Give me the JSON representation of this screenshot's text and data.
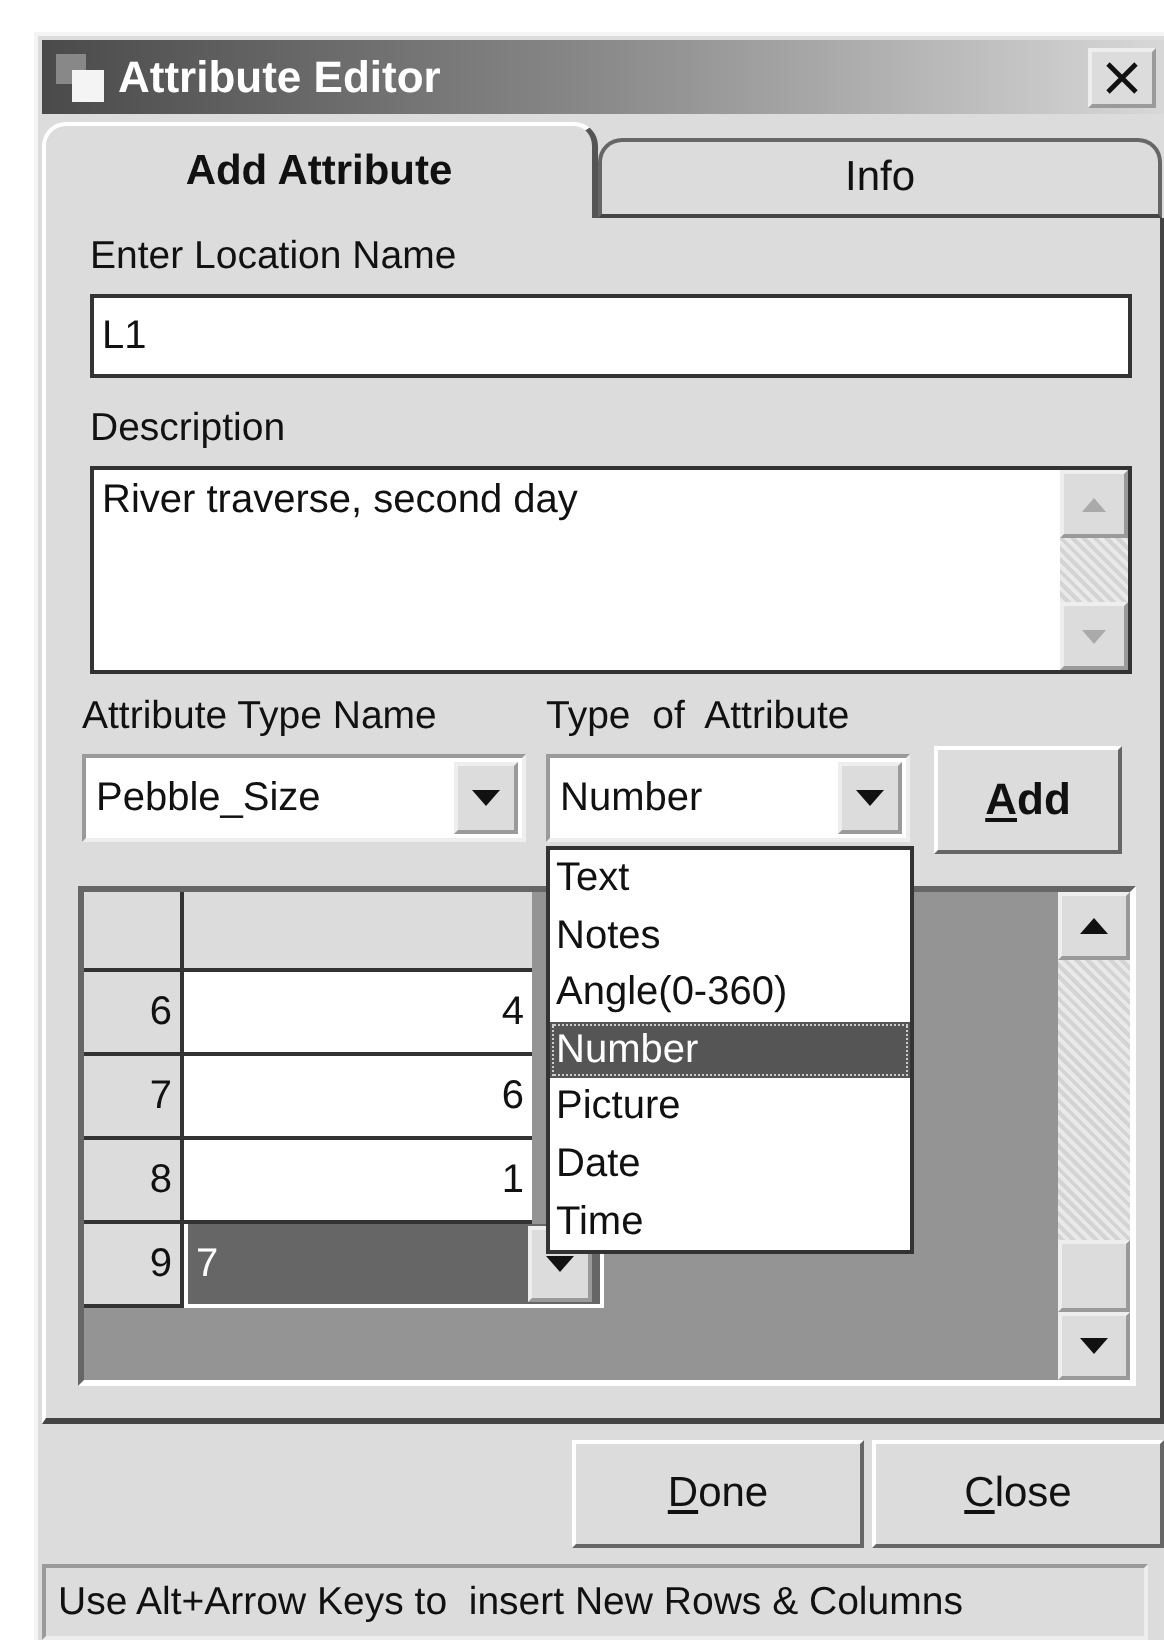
{
  "window": {
    "title": "Attribute Editor"
  },
  "tabs": [
    {
      "label": "Add Attribute",
      "selected": true
    },
    {
      "label": "Info",
      "selected": false
    }
  ],
  "location_name": {
    "label": "Enter Location Name",
    "value": "L1"
  },
  "description": {
    "label": "Description",
    "value": "River traverse, second day"
  },
  "attribute_type_name": {
    "label": "Attribute Type Name",
    "value": "Pebble_Size"
  },
  "type_of_attribute": {
    "label": "Type  of  Attribute",
    "value": "Number",
    "expanded": true,
    "options": [
      {
        "label": "Text",
        "selected": false
      },
      {
        "label": "Notes",
        "selected": false
      },
      {
        "label": "Angle(0-360)",
        "selected": false
      },
      {
        "label": "Number",
        "selected": true
      },
      {
        "label": "Picture",
        "selected": false
      },
      {
        "label": "Date",
        "selected": false
      },
      {
        "label": "Time",
        "selected": false
      }
    ]
  },
  "add_button": {
    "label": "Add",
    "underline_first": true
  },
  "grid": {
    "rows": [
      {
        "header": "6",
        "value": "4",
        "selected": false
      },
      {
        "header": "7",
        "value": "6",
        "selected": false
      },
      {
        "header": "8",
        "value": "1",
        "selected": false
      },
      {
        "header": "9",
        "value": "7",
        "selected": true
      }
    ]
  },
  "buttons": [
    {
      "label": "Done",
      "underline_first": true
    },
    {
      "label": "Close",
      "underline_first": true
    }
  ],
  "status_bar": "Use Alt+Arrow Keys to  insert New Rows & Columns"
}
